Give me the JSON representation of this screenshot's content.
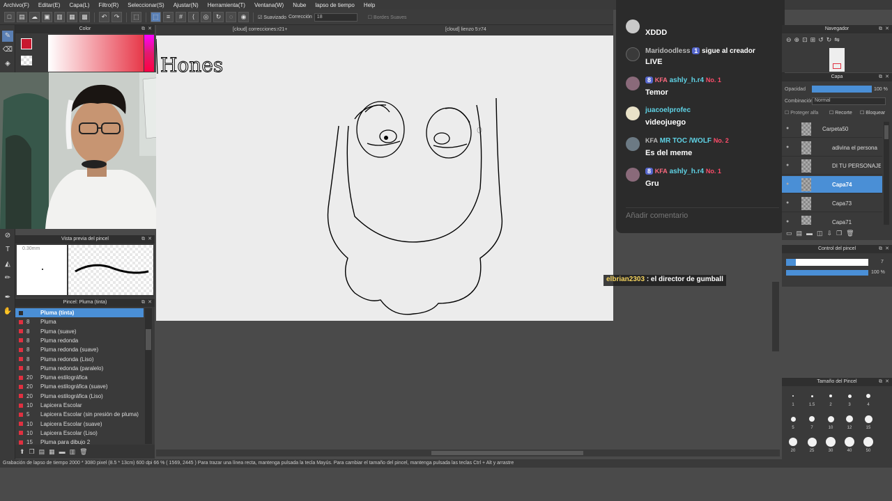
{
  "menu": [
    "Archivo(F)",
    "Editar(E)",
    "Capa(L)",
    "Filtro(R)",
    "Seleccionar(S)",
    "Ajustar(N)",
    "Herramienta(T)",
    "Ventana(W)",
    "Nube",
    "lapso de tiempo",
    "Help"
  ],
  "toolbar": {
    "smoothing_label": "Suavizado",
    "correction_label": "Corrección",
    "correction_value": "18",
    "smooth_edges_label": "Bordes Suaves"
  },
  "color_panel": {
    "title": "Color",
    "main_color": "#c8182e"
  },
  "brush_preview": {
    "title": "Vista previa del pincel",
    "size": "0.30mm"
  },
  "brush_panel": {
    "title": "Pincel: Pluma (tinta)",
    "items": [
      {
        "size": "",
        "name": "Pluma (tinta)"
      },
      {
        "size": "8",
        "name": "Pluma"
      },
      {
        "size": "8",
        "name": "Pluma (suave)"
      },
      {
        "size": "8",
        "name": "Pluma redonda"
      },
      {
        "size": "8",
        "name": "Pluma redonda (suave)"
      },
      {
        "size": "8",
        "name": "Pluma redonda (Liso)"
      },
      {
        "size": "8",
        "name": "Pluma redonda (paralelo)"
      },
      {
        "size": "20",
        "name": "Pluma estilográfica"
      },
      {
        "size": "20",
        "name": "Pluma estilográfica (suave)"
      },
      {
        "size": "20",
        "name": "Pluma estilográfica (Liso)"
      },
      {
        "size": "10",
        "name": "Lapicera Escolar"
      },
      {
        "size": "5",
        "name": "Lapicera Escolar (sin presión de pluma)"
      },
      {
        "size": "10",
        "name": "Lapicera Escolar (suave)"
      },
      {
        "size": "10",
        "name": "Lapicera Escolar (Liso)"
      },
      {
        "size": "15",
        "name": "Pluma para dibujo 2"
      }
    ]
  },
  "tabs": {
    "left": "[cloud] correcciones:r21+",
    "right": "[cloud] lienzo 5:r74"
  },
  "canvas_text": "Hones",
  "chat": {
    "messages": [
      {
        "line1_prefix": "",
        "user": "Maridoodless",
        "extra": "",
        "text": "XDDD"
      },
      {
        "line1_prefix": "",
        "user": "Maridoodless",
        "badge": "1",
        "text_inline": "sigue al creador",
        "text": "LIVE"
      },
      {
        "badge": "8",
        "kfa": "KFA",
        "user": "ashly_h.r4",
        "no": "No. 1",
        "text": "Temor"
      },
      {
        "user": "juacoelprofec",
        "text": "videojuego"
      },
      {
        "kfa": "KFA",
        "user": "MR TOC /WOLF",
        "no": "No. 2",
        "text": "Es del meme"
      },
      {
        "badge": "8",
        "kfa": "KFA",
        "user": "ashly_h.r4",
        "no": "No. 1",
        "text": "Gru"
      }
    ],
    "input_placeholder": "Añadir comentario"
  },
  "overlay": {
    "user": "elbrian2303",
    "text": " : el director de gumball"
  },
  "navigator": {
    "title": "Navegador"
  },
  "layer_panel": {
    "title": "Capa",
    "opacity_label": "Opacidad",
    "opacity_value": "100 %",
    "blend_label": "Combinación",
    "blend_value": "Normal",
    "protect_alpha": "Proteger alfa",
    "clip": "Recorte",
    "lock": "Bloquear",
    "layers": [
      "Carpeta50",
      "adivina el persona",
      "DI TU PERSONAJE",
      "Capa74",
      "Capa73",
      "Capa71"
    ]
  },
  "brush_control": {
    "title": "Control del pincel",
    "size_value": "7",
    "opacity_value": "100 %"
  },
  "brush_size": {
    "title": "Tamaño del Pincel",
    "sizes": [
      "1",
      "1.5",
      "2",
      "3",
      "4",
      "5",
      "7",
      "10",
      "12",
      "15",
      "20",
      "25",
      "30",
      "40",
      "50"
    ]
  },
  "status": {
    "text": "Grabación de lapso de tiempo   2000 * 3080 pixel   (8.5 * 13cm)   600 dpi   66 %   ( 1569, 2445 )   Para trazar una línea recta, mantenga pulsada la tecla Mayús. Para cambiar el tamaño del pincel, mantenga pulsada las teclas Ctrl + Alt y arrastre"
  }
}
